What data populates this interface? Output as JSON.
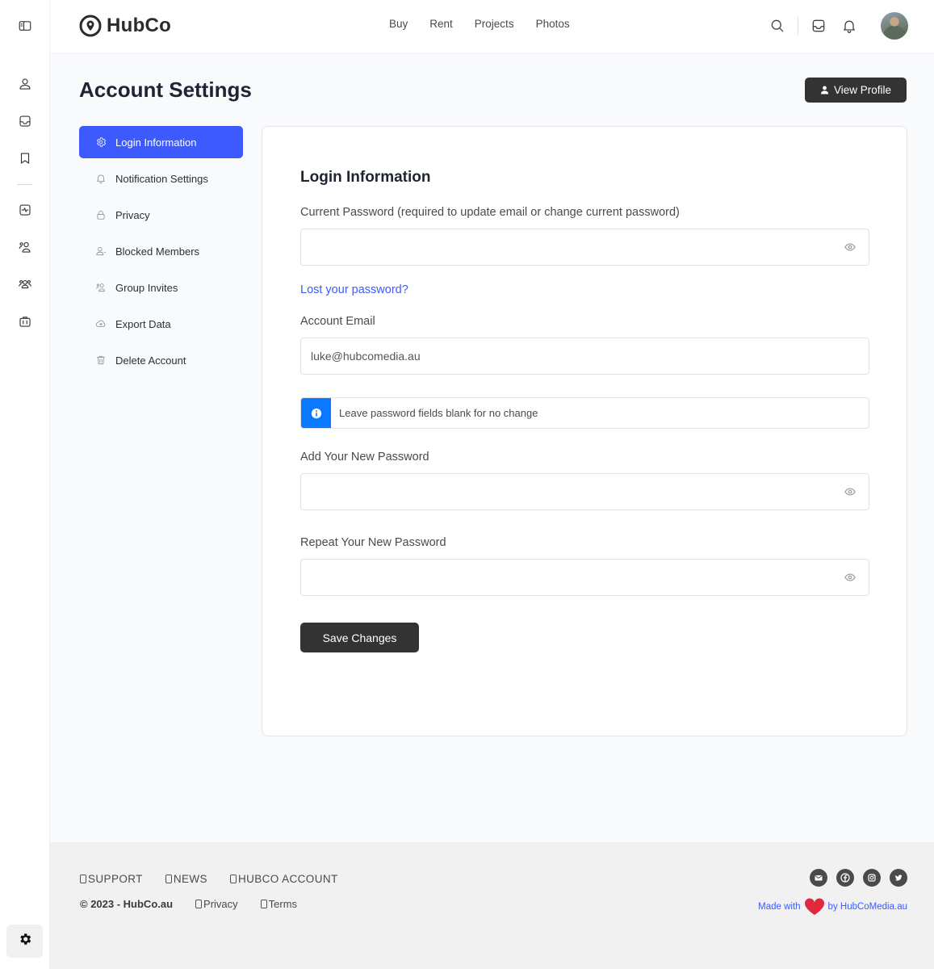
{
  "brand": {
    "name": "HubCo"
  },
  "nav": {
    "items": [
      "Buy",
      "Rent",
      "Projects",
      "Photos"
    ]
  },
  "header_icons": [
    "search-icon",
    "inbox-icon",
    "bell-icon",
    "avatar"
  ],
  "rail": {
    "icons": [
      "sidebar-toggle-icon",
      "user-icon",
      "inbox-icon",
      "bookmark-icon",
      "activity-icon",
      "friends-icon",
      "groups-icon",
      "briefcase-icon"
    ],
    "settings_icon": "gear-icon"
  },
  "page": {
    "title": "Account Settings",
    "view_profile_label": "View Profile"
  },
  "settings_menu": {
    "items": [
      {
        "label": "Login Information",
        "icon": "gear-icon",
        "active": true
      },
      {
        "label": "Notification Settings",
        "icon": "bell-icon"
      },
      {
        "label": "Privacy",
        "icon": "lock-icon"
      },
      {
        "label": "Blocked Members",
        "icon": "user-block-icon"
      },
      {
        "label": "Group Invites",
        "icon": "group-invite-icon"
      },
      {
        "label": "Export Data",
        "icon": "cloud-upload-icon"
      },
      {
        "label": "Delete Account",
        "icon": "trash-icon"
      }
    ]
  },
  "form": {
    "title": "Login Information",
    "current_password_label": "Current Password (required to update email or change current password)",
    "current_password_value": "",
    "lost_password_link": "Lost your password?",
    "email_label": "Account Email",
    "email_value": "luke@hubcomedia.au",
    "notice": "Leave password fields blank for no change",
    "new_password_label": "Add Your New Password",
    "new_password_value": "",
    "repeat_password_label": "Repeat Your New Password",
    "repeat_password_value": "",
    "save_label": "Save Changes"
  },
  "footer": {
    "links": [
      "SUPPORT",
      "NEWS",
      "HUBCO ACCOUNT"
    ],
    "copyright": "© 2023 - HubCo.au",
    "legal_links": [
      "Privacy",
      "Terms"
    ],
    "social": [
      "email-icon",
      "facebook-icon",
      "instagram-icon",
      "twitter-icon"
    ],
    "made_with_prefix": "Made with",
    "made_with_suffix": "by HubCoMedia.au"
  },
  "colors": {
    "accent": "#3d5afe",
    "info": "#0a78ff",
    "dark_button": "#333333",
    "heart": "#e0283f"
  }
}
